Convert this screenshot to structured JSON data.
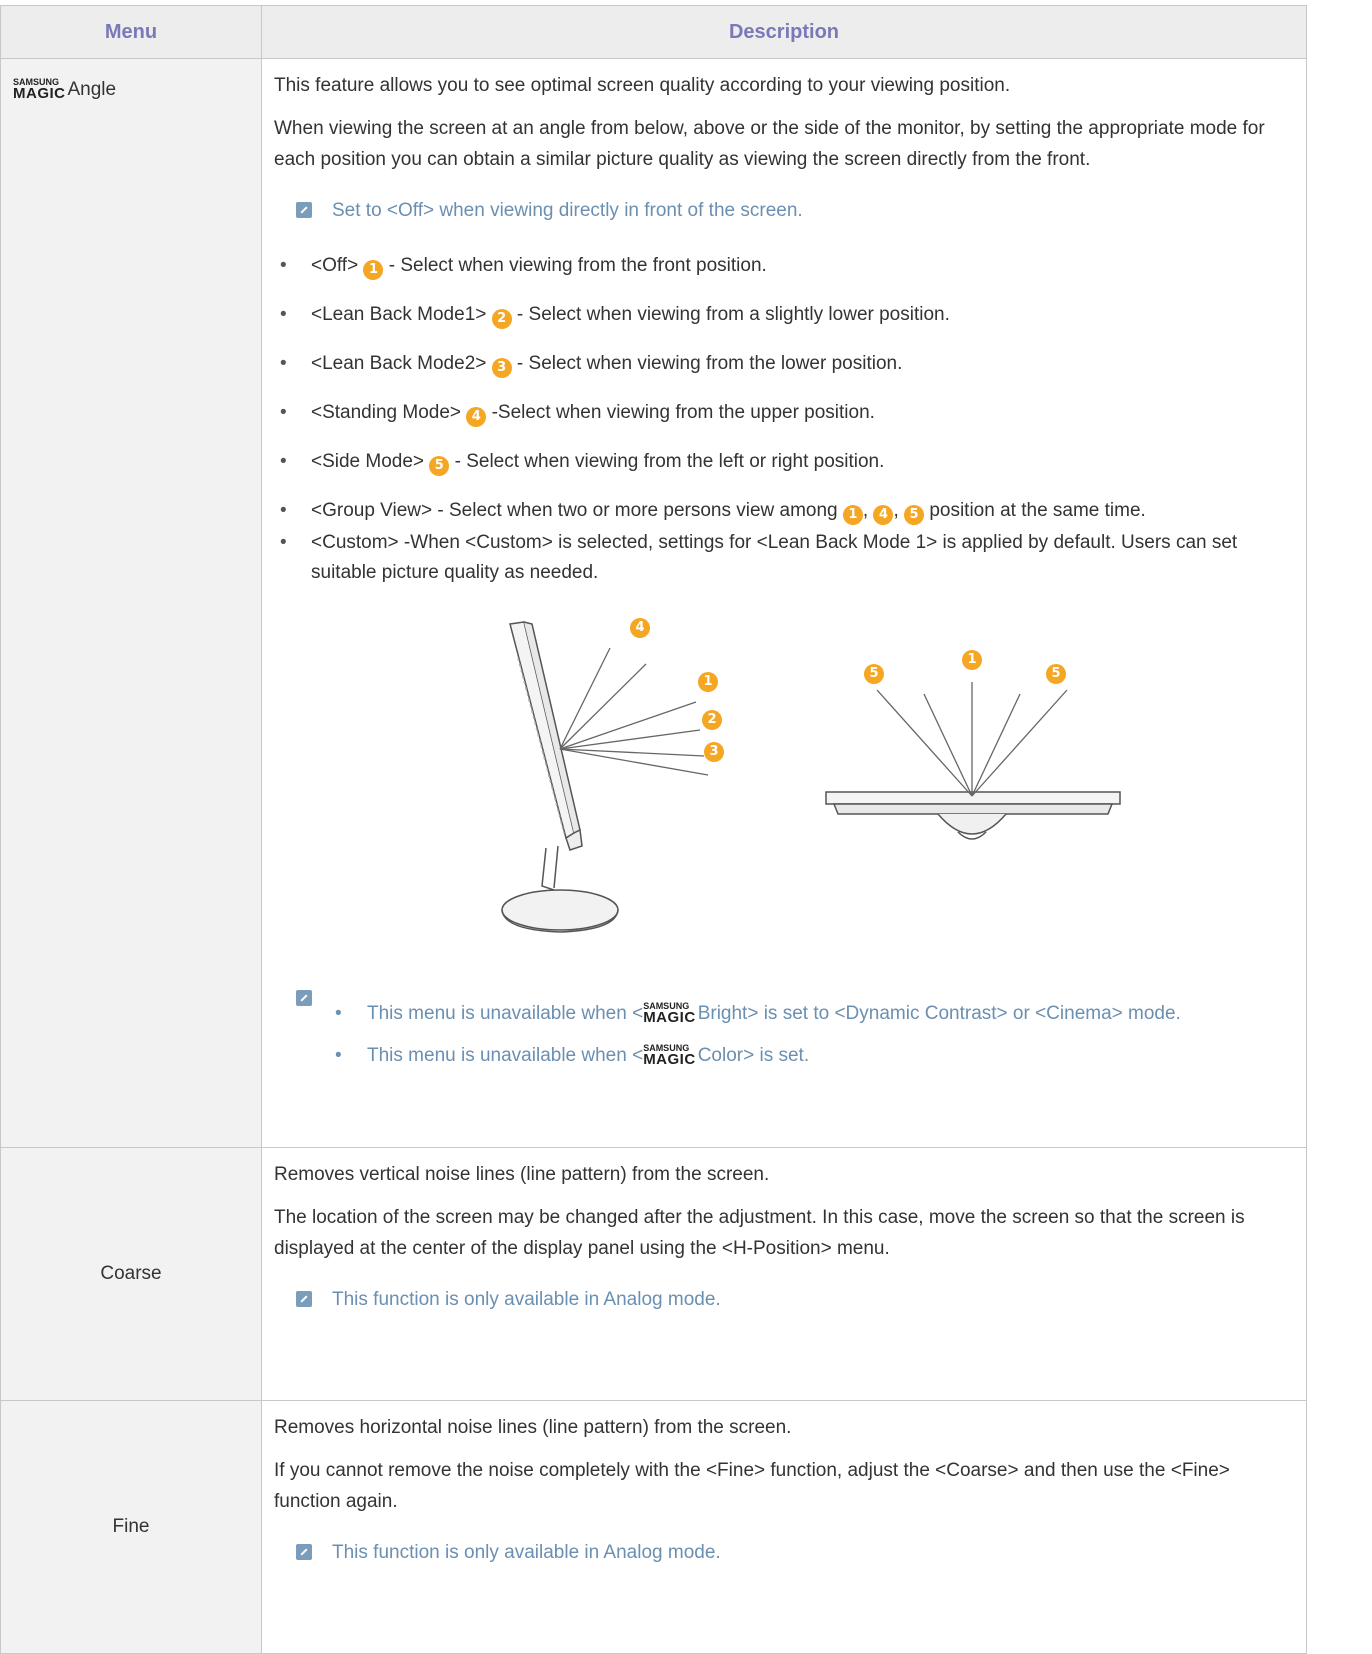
{
  "table": {
    "header_menu": "Menu",
    "header_desc": "Description"
  },
  "magic_logo": {
    "top": "SAMSUNG",
    "bottom": "MAGIC"
  },
  "rows": [
    {
      "menu": "Angle",
      "paragraphs": [
        "This feature allows you to see optimal screen quality according to your viewing position.",
        "When viewing the screen at an angle from below, above or the side of the monitor, by setting the appropriate mode for each position you can obtain a similar picture quality as viewing the screen directly from the front."
      ],
      "note": "Set to <Off> when viewing directly in front of the screen.",
      "bullets": [
        {
          "pre": "<Off>",
          "badge": "1",
          "post": "- Select when viewing from the front position."
        },
        {
          "pre": "<Lean Back Mode1>",
          "badge": "2",
          "post": "- Select when viewing from a slightly lower position."
        },
        {
          "pre": "<Lean Back Mode2>",
          "badge": "3",
          "post": "- Select when viewing from the lower position."
        },
        {
          "pre": "<Standing Mode>",
          "badge": "4",
          "post": "-Select when viewing from the upper position."
        },
        {
          "pre": "<Side Mode>",
          "badge": "5",
          "post": "- Select when viewing from the left or right position."
        }
      ],
      "group_view": {
        "pre": "<Group View>  - Select when two or more persons view among",
        "badges": [
          "1",
          "4",
          "5"
        ],
        "post": "position at the same time."
      },
      "custom": "<Custom> -When <Custom> is selected, settings for <Lean Back Mode 1> is applied by default. Users can set suitable picture quality as needed.",
      "diagram_badges": [
        "4",
        "1",
        "2",
        "3",
        "5",
        "1",
        "5"
      ],
      "notes_list": [
        {
          "pre": "This menu is unavailable when <",
          "logo_word": "Bright",
          "post": "> is set to <Dynamic Contrast> or <Cinema> mode."
        },
        {
          "pre": "This menu is unavailable when <",
          "logo_word": "Color",
          "post": "> is set."
        }
      ]
    },
    {
      "menu": "Coarse",
      "paragraphs": [
        "Removes vertical noise lines (line pattern) from the screen.",
        "The location of the screen may be changed after the adjustment. In this case, move the screen so that the screen is displayed at the center of the display panel using the <H-Position> menu."
      ],
      "note": "This function is only available in Analog mode."
    },
    {
      "menu": "Fine",
      "paragraphs": [
        "Removes horizontal noise lines (line pattern) from the screen.",
        "If you cannot remove the noise completely with the <Fine> function, adjust the <Coarse> and then use the <Fine> function again."
      ],
      "note": "This function is only available in Analog mode."
    }
  ],
  "colors": {
    "header_text": "#7b78b8",
    "note_text": "#6a8fb1",
    "badge": "#f5a623",
    "menu_bg": "#f2f2f2"
  }
}
